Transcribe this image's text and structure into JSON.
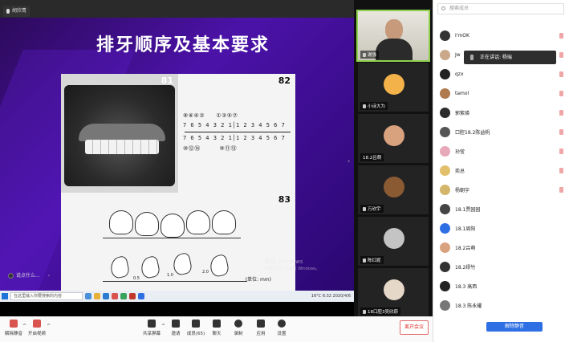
{
  "speaker_tag": "胡欣青",
  "slide": {
    "title": "排牙顺序及基本要求",
    "fig81": "81",
    "fig82": "82",
    "fig83": "83",
    "row1": "⑧⑥④②   ①③⑤⑦",
    "row2": "7 6 5 4 3 2 1│1 2 3 4 5 6 7",
    "row3": "7 6 5 4 3 2 1│1 2 3 4 5 6 7",
    "row4": "⑩⑫⑭     ⑨⑪⑬",
    "unit": "(单位: mm)",
    "m1": "0.5",
    "m2": "1.0",
    "m3": "2.0",
    "watermark_line1": "激活 Windows",
    "watermark_line2": "转到\"设置\"以激活 Windows。"
  },
  "share_overlay": "说点什么...",
  "taskbar": {
    "search_placeholder": "在这里输入你要搜索的内容",
    "tray": "16°C  6:32  2020/4/6"
  },
  "videos": [
    {
      "name": "谢强",
      "type": "camera"
    },
    {
      "name": "小诗大为",
      "type": "avatar",
      "color": "#f3b24a"
    },
    {
      "name": "18.2吕萌",
      "type": "avatar",
      "color": "#d9a27f"
    },
    {
      "name": "万欣宇",
      "type": "avatar",
      "color": "#8a5a33"
    },
    {
      "name": "陈红妮",
      "type": "avatar",
      "color": "#c4c4c4"
    },
    {
      "name": "18口腔3吴欣蔚",
      "type": "avatar",
      "color": "#e6d8c8"
    }
  ],
  "participants_panel": {
    "search_placeholder": "搜索成员",
    "toast": "正在讲话: 杨瑞",
    "members": [
      {
        "name": "I'mOK",
        "color": "#333333",
        "muted": true
      },
      {
        "name": "Jw",
        "color": "#c9a98a",
        "muted": true
      },
      {
        "name": "qzx",
        "color": "#222222",
        "muted": true
      },
      {
        "name": "tamol",
        "color": "#b07a4f",
        "muted": true
      },
      {
        "name": "郭紫瑛",
        "color": "#2c2c2c",
        "muted": true
      },
      {
        "name": "口腔18.2陈益帆",
        "color": "#555555",
        "muted": true
      },
      {
        "name": "孙莹",
        "color": "#e7a9b8",
        "muted": true
      },
      {
        "name": "奕总",
        "color": "#e2c06b",
        "muted": true
      },
      {
        "name": "杨朝宇",
        "color": "#d4b66a",
        "muted": true
      },
      {
        "name": "18.1贾园园",
        "color": "#444444",
        "muted": false
      },
      {
        "name": "18.1周阳",
        "color": "#2f6fe4",
        "muted": false
      },
      {
        "name": "18.2吕萌",
        "color": "#d9a27f",
        "muted": false
      },
      {
        "name": "18.2缪竹",
        "color": "#333333",
        "muted": false
      },
      {
        "name": "18.3 高西",
        "color": "#222222",
        "muted": false
      },
      {
        "name": "18.3 陈永耀",
        "color": "#777777",
        "muted": false
      }
    ],
    "unmute_all": "解除静音"
  },
  "controls": {
    "unmute": "解除静音",
    "start_video": "开启视频",
    "share_screen": "共享屏幕",
    "invite": "邀请",
    "members": "成员(65)",
    "chat": "聊天",
    "record": "录制",
    "apps": "应用",
    "settings": "设置",
    "leave": "离开会议"
  }
}
